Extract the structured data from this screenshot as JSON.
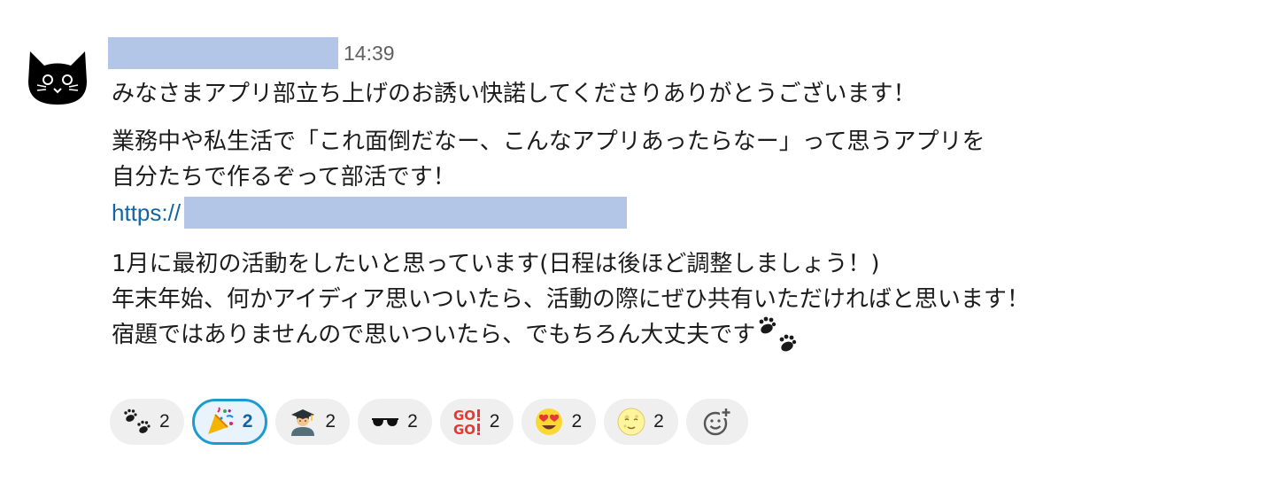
{
  "message": {
    "author_name": "",
    "timestamp": "14:39",
    "lines": [
      "みなさまアプリ部立ち上げのお誘い快諾してくださりありがとうございます！",
      "業務中や私生活で「これ面倒だなー、こんなアプリあったらなー」って思うアプリを",
      "自分たちで作るぞって部活です！",
      "1月に最初の活動をしたいと思っています(日程は後ほど調整しましょう！)",
      "年末年始、何かアイディア思いついたら、活動の際にぜひ共有いただければと思います！",
      "宿題ではありませんので思いついたら、でもちろん大丈夫です"
    ],
    "link_prefix": "https://",
    "inline_emoji": "paw-prints-icon"
  },
  "reactions": [
    {
      "emoji": "paw-prints-icon",
      "count": "2",
      "active": false
    },
    {
      "emoji": "party-popper-icon",
      "count": "2",
      "active": true
    },
    {
      "emoji": "student-icon",
      "count": "2",
      "active": false
    },
    {
      "emoji": "sunglasses-icon",
      "count": "2",
      "active": false
    },
    {
      "emoji": "go-go-icon",
      "count": "2",
      "active": false
    },
    {
      "emoji": "heart-eyes-icon",
      "count": "2",
      "active": false
    },
    {
      "emoji": "full-moon-face-icon",
      "count": "2",
      "active": false
    }
  ],
  "colors": {
    "link": "#1264a3",
    "active_border": "#1d9bd1",
    "redaction": "#b4c6e7"
  }
}
